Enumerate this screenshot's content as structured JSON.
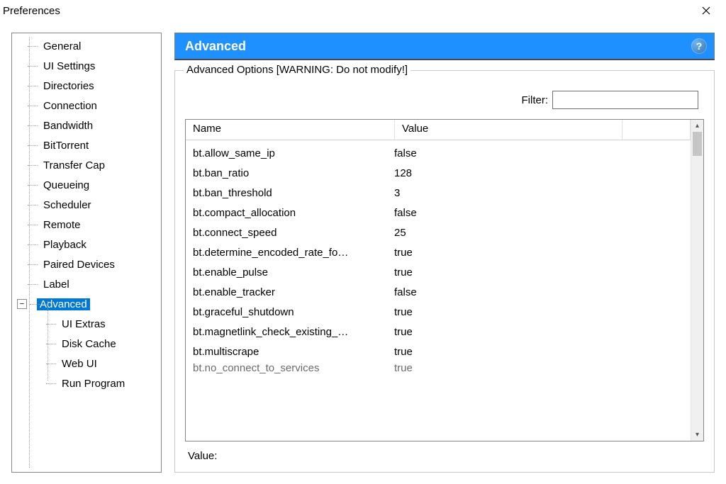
{
  "window": {
    "title": "Preferences"
  },
  "tree": {
    "items": [
      {
        "label": "General"
      },
      {
        "label": "UI Settings"
      },
      {
        "label": "Directories"
      },
      {
        "label": "Connection"
      },
      {
        "label": "Bandwidth"
      },
      {
        "label": "BitTorrent"
      },
      {
        "label": "Transfer Cap"
      },
      {
        "label": "Queueing"
      },
      {
        "label": "Scheduler"
      },
      {
        "label": "Remote"
      },
      {
        "label": "Playback"
      },
      {
        "label": "Paired Devices"
      },
      {
        "label": "Label"
      },
      {
        "label": "Advanced",
        "selected": true,
        "expanded": true
      }
    ],
    "subitems": [
      {
        "label": "UI Extras"
      },
      {
        "label": "Disk Cache"
      },
      {
        "label": "Web UI"
      },
      {
        "label": "Run Program"
      }
    ]
  },
  "header": {
    "title": "Advanced"
  },
  "group": {
    "legend": "Advanced Options [WARNING: Do not modify!]",
    "filter_label": "Filter:",
    "filter_value": "",
    "columns": {
      "name": "Name",
      "value": "Value"
    },
    "rows": [
      {
        "name": "bt.allow_same_ip",
        "value": "false"
      },
      {
        "name": "bt.ban_ratio",
        "value": "128"
      },
      {
        "name": "bt.ban_threshold",
        "value": "3"
      },
      {
        "name": "bt.compact_allocation",
        "value": "false"
      },
      {
        "name": "bt.connect_speed",
        "value": "25"
      },
      {
        "name": "bt.determine_encoded_rate_fo…",
        "value": "true"
      },
      {
        "name": "bt.enable_pulse",
        "value": "true"
      },
      {
        "name": "bt.enable_tracker",
        "value": "false"
      },
      {
        "name": "bt.graceful_shutdown",
        "value": "true"
      },
      {
        "name": "bt.magnetlink_check_existing_…",
        "value": "true"
      },
      {
        "name": "bt.multiscrape",
        "value": "true"
      },
      {
        "name": "bt.no_connect_to_services",
        "value": "true"
      }
    ],
    "value_label": "Value:"
  }
}
